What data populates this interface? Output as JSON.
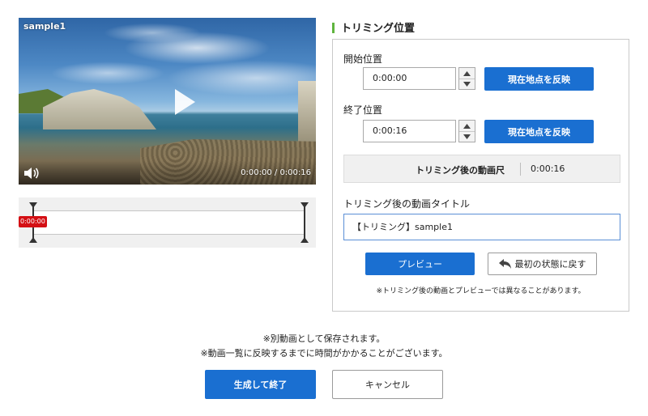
{
  "video": {
    "title": "sample1",
    "time_display": "0:00:00 / 0:00:16",
    "icons": {
      "play": "play-icon",
      "volume": "volume-icon"
    }
  },
  "timeline": {
    "cursor_time": "0:00:00",
    "cursor_color": "#d40f14"
  },
  "trimming": {
    "section_title": "トリミング位置",
    "accent_color": "#5fb43e",
    "start": {
      "label": "開始位置",
      "value": "0:00:00",
      "button": "現在地点を反映"
    },
    "end": {
      "label": "終了位置",
      "value": "0:00:16",
      "button": "現在地点を反映"
    },
    "duration": {
      "label": "トリミング後の動画尺",
      "value": "0:00:16"
    },
    "title_field": {
      "label": "トリミング後の動画タイトル",
      "value": "【トリミング】sample1"
    },
    "preview_button": "プレビュー",
    "reset_button": "最初の状態に戻す",
    "note": "※トリミング後の動画とプレビューでは異なることがあります。"
  },
  "footer": {
    "note_line1": "※別動画として保存されます。",
    "note_line2": "※動画一覧に反映するまでに時間がかかることがございます。",
    "create_button": "生成して終了",
    "cancel_button": "キャンセル"
  },
  "colors": {
    "primary": "#1a6fd1"
  }
}
